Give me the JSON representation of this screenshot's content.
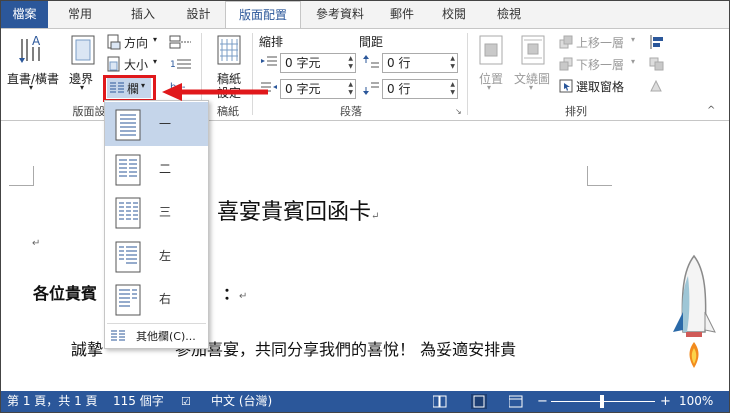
{
  "tabs": [
    "檔案",
    "常用",
    "插入",
    "設計",
    "版面配置",
    "參考資料",
    "郵件",
    "校閱",
    "檢視"
  ],
  "ribbon": {
    "text_direction": "直書/橫書",
    "margins": "邊界",
    "orientation": "方向",
    "size": "大小",
    "columns": "欄",
    "page_setup_group": "版面設",
    "manuscript": "稿紙",
    "manuscript2": "設定",
    "manuscript_group": "稿紙",
    "indent_header": "縮排",
    "spacing_header": "間距",
    "indent_left": "0 字元",
    "indent_right": "0 字元",
    "spacing_before": "0 行",
    "spacing_after": "0 行",
    "paragraph_group": "段落",
    "position": "位置",
    "wrap_text": "文繞圖",
    "bring_forward": "上移一層",
    "send_backward": "下移一層",
    "selection_pane": "選取窗格",
    "arrange_group": "排列"
  },
  "columns_menu": {
    "items": [
      "一",
      "二",
      "三",
      "左",
      "右"
    ],
    "more": "其他欄(C)..."
  },
  "document": {
    "title": "喜宴貴賓回函卡",
    "greeting_start": "各位貴賓",
    "greeting_end": "：",
    "body_start": "誠摯",
    "body_rest": "參加喜宴，共同分享我們的喜悅！ 為妥適安排貴",
    "para_mark": "↵"
  },
  "status": {
    "page": "第 1 頁，共 1 頁",
    "words": "115 個字",
    "language": "中文 (台灣)",
    "zoom": "100%"
  },
  "colors": {
    "accent": "#2b579a",
    "highlight": "#e0181b"
  }
}
